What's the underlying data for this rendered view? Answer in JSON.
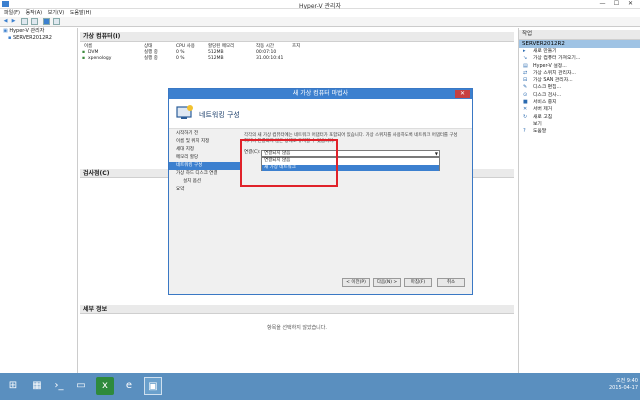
{
  "window": {
    "title": "Hyper-V 관리자",
    "minimize": "—",
    "maximize": "☐",
    "close": "✕"
  },
  "menu": [
    "파일(F)",
    "동작(A)",
    "보기(V)",
    "도움말(H)"
  ],
  "tree": {
    "root": "Hyper-V 관리자",
    "server": "SERVER2012R2"
  },
  "center": {
    "vm_header": "가상 컴퓨터(I)",
    "columns": [
      "이름",
      "상태",
      "CPU 사용",
      "할당된 메모리",
      "작동 시간",
      "흐지"
    ],
    "vms": [
      {
        "name": "DVM",
        "state": "실행 중",
        "cpu": "0 %",
        "memory": "512MB",
        "uptime": "00:07:10",
        "status": ""
      },
      {
        "name": "xpenology",
        "state": "실행 중",
        "cpu": "0 %",
        "memory": "512MB",
        "uptime": "31.00:10:41",
        "status": ""
      }
    ],
    "checkpoint_header": "검사점(C)",
    "details_header": "세부 정보",
    "details_message": "항목을 선택하지 않았습니다."
  },
  "actions": {
    "header": "작업",
    "server": "SERVER2012R2",
    "items": [
      {
        "icon": "▸",
        "label": "새로 만들기"
      },
      {
        "icon": "↘",
        "label": "가상 컴퓨터 가져오기..."
      },
      {
        "icon": "▤",
        "label": "Hyper-V 설정..."
      },
      {
        "icon": "⇄",
        "label": "가상 스위치 관리자..."
      },
      {
        "icon": "⊟",
        "label": "가상 SAN 관리자..."
      },
      {
        "icon": "✎",
        "label": "디스크 편집..."
      },
      {
        "icon": "⊙",
        "label": "디스크 검사..."
      },
      {
        "icon": "■",
        "label": "서비스 중지"
      },
      {
        "icon": "✕",
        "label": "서버 제거"
      },
      {
        "icon": "↻",
        "label": "새로 고침"
      },
      {
        "icon": "",
        "label": "보기"
      },
      {
        "icon": "?",
        "label": "도움말"
      }
    ]
  },
  "dialog": {
    "title": "새 가상 컴퓨터 마법사",
    "close": "✕",
    "page_title": "네트워킹 구성",
    "steps": [
      {
        "label": "시작하기 전",
        "current": false,
        "sub": false
      },
      {
        "label": "이름 및 위치 지정",
        "current": false,
        "sub": false
      },
      {
        "label": "세대 지정",
        "current": false,
        "sub": false
      },
      {
        "label": "메모리 할당",
        "current": false,
        "sub": false
      },
      {
        "label": "네트워킹 구성",
        "current": true,
        "sub": false
      },
      {
        "label": "가상 하드 디스크 연결",
        "current": false,
        "sub": false
      },
      {
        "label": "설치 옵션",
        "current": false,
        "sub": true
      },
      {
        "label": "요약",
        "current": false,
        "sub": false
      }
    ],
    "body_line1": "각각의 새 가상 컴퓨터에는 네트워크 어댑터가 포함되어 있습니다. 가상 스위치를 사용하도록 네트워크 어댑터를 구성",
    "body_line2": "하거나 연결되지 않은 상태로 유지할 수 있습니다.",
    "connection_label": "연결(C):",
    "connection_value": "연결되지 않음",
    "dropdown_options": [
      "연결되지 않음",
      "새 가상 네트워크"
    ],
    "buttons": {
      "prev": "< 이전(P)",
      "next": "다음(N) >",
      "finish": "마침(F)",
      "cancel": "취소"
    }
  },
  "taskbar": {
    "time": "오전 9:40",
    "date": "2015-04-17"
  }
}
